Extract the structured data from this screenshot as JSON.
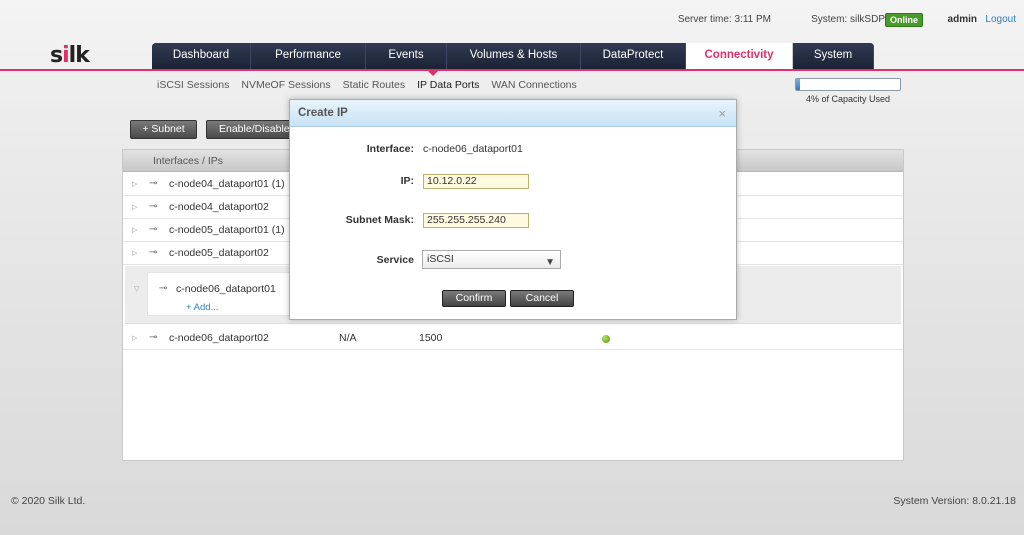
{
  "topbar": {
    "server_time": "Server time: 3:11 PM",
    "system": "System: silkSDP",
    "status_badge": "Online",
    "user": "admin",
    "logout": "Logout"
  },
  "brand": {
    "logo_text_pre": "s",
    "logo_i": "i",
    "logo_text_post": "lk"
  },
  "nav": {
    "tabs": [
      {
        "label": "Dashboard"
      },
      {
        "label": "Performance"
      },
      {
        "label": "Events"
      },
      {
        "label": "Volumes & Hosts"
      },
      {
        "label": "DataProtect"
      },
      {
        "label": "Connectivity"
      },
      {
        "label": "System"
      }
    ],
    "active_tab": "Connectivity"
  },
  "subnav": {
    "items": [
      {
        "label": "iSCSI Sessions"
      },
      {
        "label": "NVMeOF Sessions"
      },
      {
        "label": "Static Routes"
      },
      {
        "label": "IP Data Ports"
      },
      {
        "label": "WAN Connections"
      }
    ],
    "active": "IP Data Ports"
  },
  "capacity": {
    "percent_used": 4,
    "label": "4% of Capacity Used"
  },
  "toolbar": {
    "add_subnet": "+ Subnet",
    "enable_disable": "Enable/Disable"
  },
  "grid": {
    "header": "Interfaces / IPs",
    "rows": [
      {
        "name": "c-node04_dataport01 (1)"
      },
      {
        "name": "c-node04_dataport02"
      },
      {
        "name": "c-node05_dataport01 (1)"
      },
      {
        "name": "c-node05_dataport02"
      }
    ],
    "expanded": {
      "name": "c-node06_dataport01",
      "add_label": "+ Add..."
    },
    "last_row": {
      "name": "c-node06_dataport02",
      "col2": "N/A",
      "col3": "1500",
      "status_color": "#5a9e1a"
    }
  },
  "modal": {
    "title": "Create IP",
    "close": "×",
    "interface_label": "Interface:",
    "interface_value": "c-node06_dataport01",
    "ip_label": "IP:",
    "ip_value": "10.12.0.22",
    "mask_label": "Subnet Mask:",
    "mask_value": "255.255.255.240",
    "service_label": "Service",
    "service_value": "iSCSI",
    "confirm": "Confirm",
    "cancel": "Cancel"
  },
  "footer": {
    "copyright": "© 2020 Silk Ltd.",
    "version": "System Version: 8.0.21.18"
  },
  "colors": {
    "accent": "#e0306a",
    "nav_bg": "#1d2538",
    "online": "#4a9a2a",
    "link": "#2a7fc6"
  }
}
